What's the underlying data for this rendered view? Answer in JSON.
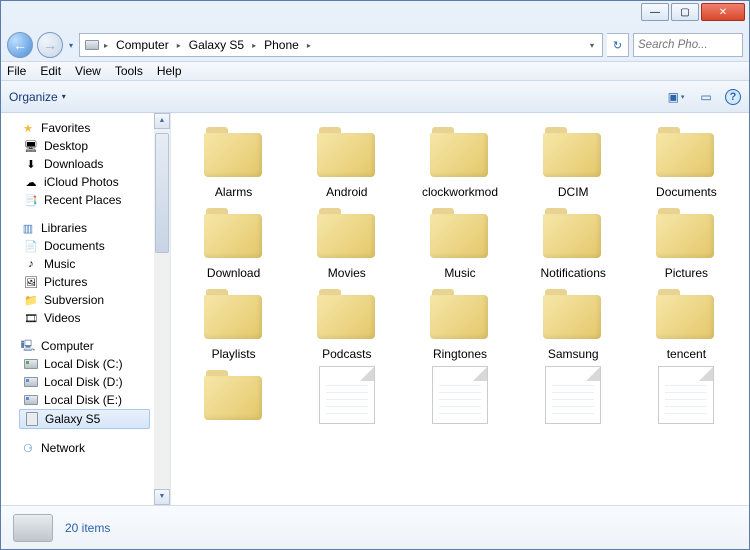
{
  "window_controls": {
    "min": "—",
    "max": "▢",
    "close": "✕"
  },
  "nav": {
    "back_glyph": "←",
    "fwd_glyph": "→",
    "chevron": "▾"
  },
  "breadcrumb": {
    "items": [
      "Computer",
      "Galaxy S5",
      "Phone"
    ],
    "sep": "▸",
    "drop": "▾",
    "refresh": "↻"
  },
  "search": {
    "placeholder": "Search Pho..."
  },
  "menu": {
    "items": [
      "File",
      "Edit",
      "View",
      "Tools",
      "Help"
    ]
  },
  "toolbar": {
    "organize": "Organize",
    "drop": "▾",
    "view_glyph": "▣",
    "pane_glyph": "▭",
    "help_glyph": "?"
  },
  "tree": {
    "favorites": {
      "label": "Favorites",
      "items": [
        {
          "label": "Desktop",
          "icon": "🖥"
        },
        {
          "label": "Downloads",
          "icon": "⬇"
        },
        {
          "label": "iCloud Photos",
          "icon": "☁"
        },
        {
          "label": "Recent Places",
          "icon": "📑"
        }
      ]
    },
    "libraries": {
      "label": "Libraries",
      "items": [
        {
          "label": "Documents",
          "icon": "📄"
        },
        {
          "label": "Music",
          "icon": "♪"
        },
        {
          "label": "Pictures",
          "icon": "🖼"
        },
        {
          "label": "Subversion",
          "icon": "📁"
        },
        {
          "label": "Videos",
          "icon": "🎞"
        }
      ]
    },
    "computer": {
      "label": "Computer",
      "items": [
        {
          "label": "Local Disk (C:)"
        },
        {
          "label": "Local Disk (D:)"
        },
        {
          "label": "Local Disk (E:)"
        },
        {
          "label": "Galaxy S5",
          "selected": true
        }
      ]
    },
    "network": {
      "label": "Network"
    }
  },
  "folders": [
    {
      "name": "Alarms",
      "type": "folder"
    },
    {
      "name": "Android",
      "type": "folder"
    },
    {
      "name": "clockworkmod",
      "type": "folder"
    },
    {
      "name": "DCIM",
      "type": "folder"
    },
    {
      "name": "Documents",
      "type": "folder"
    },
    {
      "name": "Download",
      "type": "folder"
    },
    {
      "name": "Movies",
      "type": "folder"
    },
    {
      "name": "Music",
      "type": "folder"
    },
    {
      "name": "Notifications",
      "type": "folder"
    },
    {
      "name": "Pictures",
      "type": "folder"
    },
    {
      "name": "Playlists",
      "type": "folder"
    },
    {
      "name": "Podcasts",
      "type": "folder"
    },
    {
      "name": "Ringtones",
      "type": "folder"
    },
    {
      "name": "Samsung",
      "type": "folder"
    },
    {
      "name": "tencent",
      "type": "folder"
    },
    {
      "name": "",
      "type": "folder"
    },
    {
      "name": "",
      "type": "file"
    },
    {
      "name": "",
      "type": "file"
    },
    {
      "name": "",
      "type": "file"
    },
    {
      "name": "",
      "type": "file"
    }
  ],
  "status": {
    "count": "20 items"
  }
}
